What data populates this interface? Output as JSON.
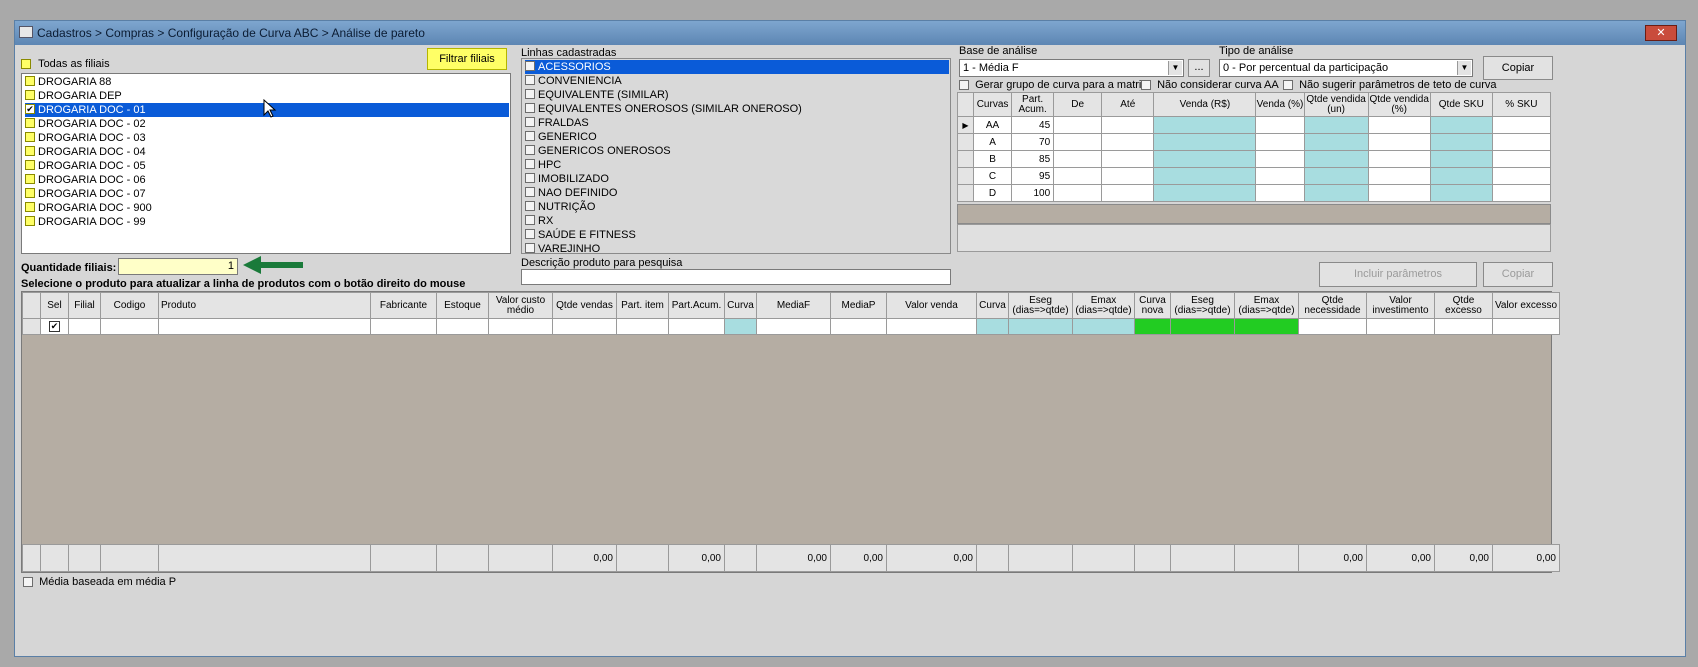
{
  "window": {
    "title": "Cadastros > Compras > Configuração de Curva ABC > Análise de pareto",
    "close_glyph": "✕"
  },
  "filiais": {
    "todas_label": "Todas as filiais",
    "filtrar_button": "Filtrar filiais",
    "items": [
      {
        "label": "DROGARIA 88",
        "checked": false,
        "selected": false
      },
      {
        "label": "DROGARIA DEP",
        "checked": false,
        "selected": false
      },
      {
        "label": "DROGARIA DOC - 01",
        "checked": true,
        "selected": true
      },
      {
        "label": "DROGARIA DOC - 02",
        "checked": false,
        "selected": false
      },
      {
        "label": "DROGARIA DOC - 03",
        "checked": false,
        "selected": false
      },
      {
        "label": "DROGARIA DOC - 04",
        "checked": false,
        "selected": false
      },
      {
        "label": "DROGARIA DOC - 05",
        "checked": false,
        "selected": false
      },
      {
        "label": "DROGARIA DOC - 06",
        "checked": false,
        "selected": false
      },
      {
        "label": "DROGARIA DOC - 07",
        "checked": false,
        "selected": false
      },
      {
        "label": "DROGARIA DOC - 900",
        "checked": false,
        "selected": false
      },
      {
        "label": "DROGARIA DOC - 99",
        "checked": false,
        "selected": false
      }
    ],
    "quantidade_label": "Quantidade filiais:",
    "quantidade_value": "1"
  },
  "linhas": {
    "label": "Linhas cadastradas",
    "items": [
      {
        "label": "ACESSORIOS",
        "selected": true
      },
      {
        "label": "CONVENIENCIA",
        "selected": false
      },
      {
        "label": "EQUIVALENTE (SIMILAR)",
        "selected": false
      },
      {
        "label": "EQUIVALENTES ONEROSOS (SIMILAR ONEROSO)",
        "selected": false
      },
      {
        "label": "FRALDAS",
        "selected": false
      },
      {
        "label": "GENERICO",
        "selected": false
      },
      {
        "label": "GENERICOS ONEROSOS",
        "selected": false
      },
      {
        "label": "HPC",
        "selected": false
      },
      {
        "label": "IMOBILIZADO",
        "selected": false
      },
      {
        "label": "NAO DEFINIDO",
        "selected": false
      },
      {
        "label": "NUTRIÇÃO",
        "selected": false
      },
      {
        "label": "RX",
        "selected": false
      },
      {
        "label": "SAÚDE E FITNESS",
        "selected": false
      },
      {
        "label": "VAREJINHO",
        "selected": false
      }
    ],
    "descricao_label": "Descrição produto para pesquisa",
    "descricao_value": ""
  },
  "analise": {
    "base_label": "Base de análise",
    "base_value": "1 - Média F",
    "ellipsis": "...",
    "tipo_label": "Tipo de análise",
    "tipo_value": "0 - Por percentual da participação",
    "copiar_top": "Copiar",
    "opt_gerar": "Gerar grupo de curva para a matriz",
    "opt_nao_aa": "Não considerar curva AA",
    "opt_nao_sugerir": "Não sugerir parâmetros de teto de curva",
    "headers": [
      "Curvas",
      "Part. Acum.",
      "De",
      "Até",
      "Venda (R$)",
      "Venda (%)",
      "Qtde vendida (un)",
      "Qtde vendida (%)",
      "Qtde SKU",
      "% SKU"
    ],
    "rows": [
      {
        "curva": "AA",
        "part": "45",
        "current": true
      },
      {
        "curva": "A",
        "part": "70",
        "current": false
      },
      {
        "curva": "B",
        "part": "85",
        "current": false
      },
      {
        "curva": "C",
        "part": "95",
        "current": false
      },
      {
        "curva": "D",
        "part": "100",
        "current": false
      }
    ],
    "incluir_button": "Incluir parâmetros",
    "copiar_bottom": "Copiar"
  },
  "produtos": {
    "hint": "Selecione o produto para atualizar a linha de produtos com o botão direito do mouse",
    "headers": [
      "Sel",
      "Filial",
      "Codigo",
      "Produto",
      "Fabricante",
      "Estoque",
      "Valor custo médio",
      "Qtde vendas",
      "Part. item",
      "Part.Acum.",
      "Curva",
      "MediaF",
      "MediaP",
      "Valor venda",
      "Curva",
      "Eseg (dias=>qtde)",
      "Emax (dias=>qtde)",
      "Curva nova",
      "Eseg (dias=>qtde)",
      "Emax (dias=>qtde)",
      "Qtde necessidade",
      "Valor investimento",
      "Qtde excesso",
      "Valor excesso"
    ],
    "totals": [
      "",
      "",
      "",
      "",
      "",
      "",
      "",
      "0,00",
      "",
      "0,00",
      "",
      "0,00",
      "0,00",
      "0,00",
      "",
      "",
      "",
      "",
      "",
      "",
      "0,00",
      "0,00",
      "0,00",
      "0,00"
    ]
  },
  "footer": {
    "media_label": "Média baseada em média P"
  },
  "colors": {
    "highlight": "#ffff66",
    "teal": "#a8dde0",
    "green": "#22cc22",
    "selection": "#0a5bd8",
    "arrow": "#1a7a3a"
  }
}
